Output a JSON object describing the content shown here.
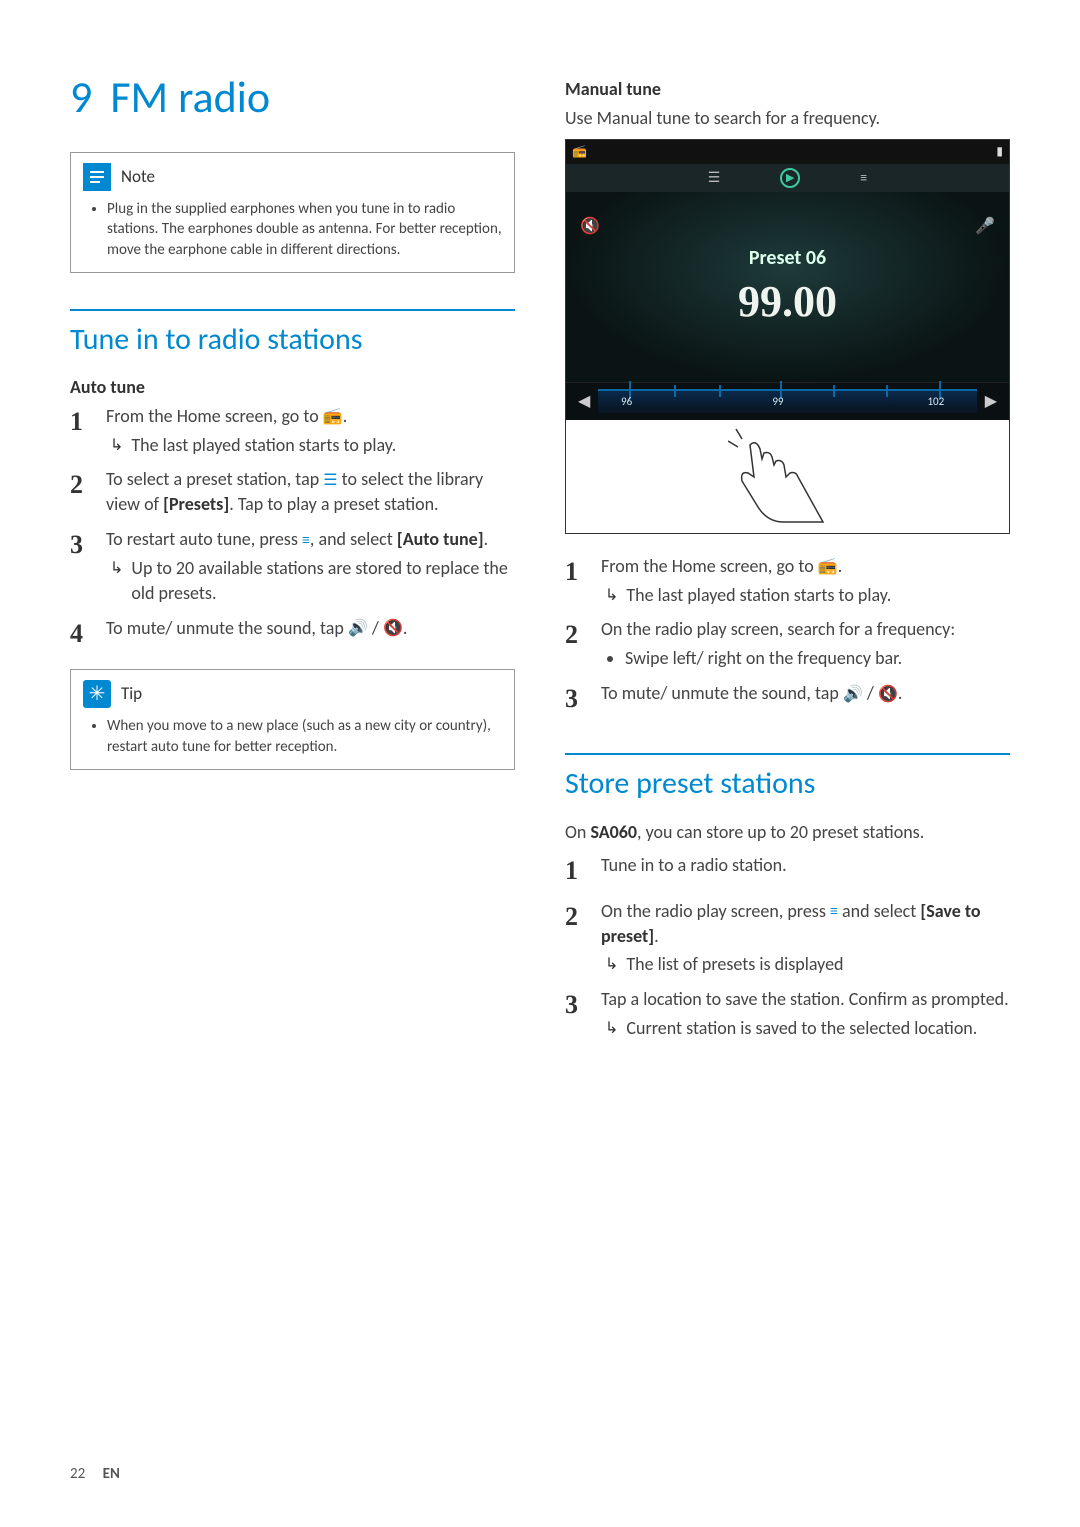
{
  "chapter": {
    "number": "9",
    "title": "FM radio"
  },
  "note": {
    "label": "Note",
    "text": "Plug in the supplied earphones when you tune in to radio stations. The earphones double as antenna. For better reception, move the earphone cable in different directions."
  },
  "section_tune": {
    "title": "Tune in to radio stations",
    "auto": {
      "subhead": "Auto tune",
      "steps": [
        {
          "n": "1",
          "text_a": "From the Home screen, go to ",
          "text_b": ".",
          "result": "The last played station starts to play."
        },
        {
          "n": "2",
          "text_a": "To select a preset station, tap ",
          "text_b": " to select the library view of ",
          "bold": "[Presets]",
          "text_c": ". Tap to play a preset station."
        },
        {
          "n": "3",
          "text_a": "To restart auto tune, press ",
          "text_b": ", and select ",
          "bold": "[Auto tune]",
          "text_c": ".",
          "result": "Up to 20 available stations are stored to replace the old presets."
        },
        {
          "n": "4",
          "text_a": "To mute/ unmute the sound, tap ",
          "text_b": " / ",
          "text_c": "."
        }
      ]
    },
    "tip": {
      "label": "Tip",
      "text": "When you move to a new place (such as a new city or country), restart auto tune for better reception."
    },
    "manual": {
      "subhead": "Manual tune",
      "intro": "Use Manual tune to search for a frequency.",
      "screenshot": {
        "preset_label": "Preset 06",
        "frequency": "99.00",
        "scale_left": "96",
        "scale_mid": "99",
        "scale_right": "102"
      },
      "steps": [
        {
          "n": "1",
          "text_a": "From the Home screen, go to ",
          "text_b": ".",
          "result": "The last played station starts to play."
        },
        {
          "n": "2",
          "text_a": "On the radio play screen, search for a frequency:",
          "bullet": "Swipe left/ right on the frequency bar."
        },
        {
          "n": "3",
          "text_a": "To mute/ unmute the sound, tap ",
          "text_b": " / ",
          "text_c": "."
        }
      ]
    }
  },
  "section_store": {
    "title": "Store preset stations",
    "intro_a": "On ",
    "intro_bold": "SA060",
    "intro_b": ", you can store up to 20 preset stations.",
    "steps": [
      {
        "n": "1",
        "text_a": "Tune in to a radio station."
      },
      {
        "n": "2",
        "text_a": "On the radio play screen, press ",
        "text_b": " and select ",
        "bold": "[Save to preset]",
        "text_c": ".",
        "result": "The list of presets is displayed"
      },
      {
        "n": "3",
        "text_a": "Tap a location to save the station. Confirm as prompted.",
        "result": "Current station is saved to the selected location."
      }
    ]
  },
  "footer": {
    "page": "22",
    "lang": "EN"
  }
}
